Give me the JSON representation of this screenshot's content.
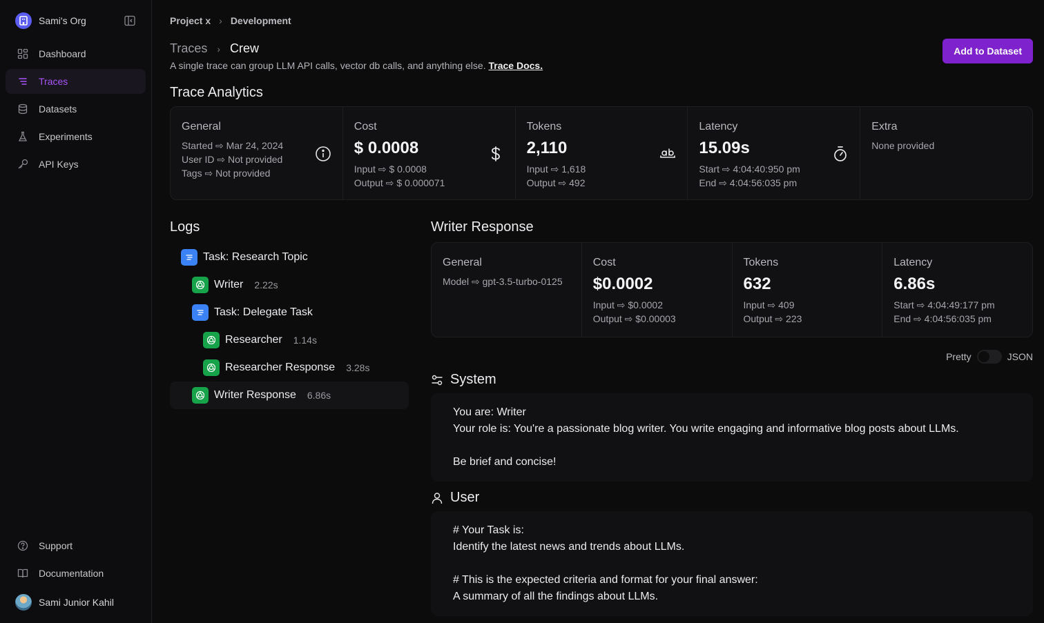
{
  "org": {
    "name": "Sami's Org"
  },
  "sidebar": {
    "items": [
      {
        "label": "Dashboard",
        "icon": "dashboard-icon"
      },
      {
        "label": "Traces",
        "icon": "traces-icon",
        "active": true
      },
      {
        "label": "Datasets",
        "icon": "database-icon"
      },
      {
        "label": "Experiments",
        "icon": "flask-icon"
      },
      {
        "label": "API Keys",
        "icon": "key-icon"
      }
    ],
    "bottom": [
      {
        "label": "Support",
        "icon": "help-circle-icon"
      },
      {
        "label": "Documentation",
        "icon": "book-icon"
      }
    ],
    "user": {
      "name": "Sami Junior Kahil"
    }
  },
  "breadcrumb": {
    "project": "Project x",
    "env": "Development"
  },
  "header": {
    "parent": "Traces",
    "current": "Crew",
    "subtitle": "A single trace can group LLM API calls, vector db calls, and anything else.",
    "docs_link": "Trace Docs.",
    "add_button": "Add to Dataset"
  },
  "analytics": {
    "title": "Trace Analytics",
    "general": {
      "label": "General",
      "started": "Started ⇨ Mar 24, 2024",
      "user": "User ID ⇨ Not provided",
      "tags": "Tags ⇨ Not provided"
    },
    "cost": {
      "label": "Cost",
      "value": "$ 0.0008",
      "input": "Input ⇨ $ 0.0008",
      "output": "Output ⇨ $ 0.000071"
    },
    "tokens": {
      "label": "Tokens",
      "value": "2,110",
      "input": "Input ⇨ 1,618",
      "output": "Output ⇨ 492"
    },
    "latency": {
      "label": "Latency",
      "value": "15.09s",
      "start": "Start ⇨ 4:04:40:950 pm",
      "end": "End ⇨ 4:04:56:035 pm"
    },
    "extra": {
      "label": "Extra",
      "value": "None provided"
    }
  },
  "logs": {
    "title": "Logs",
    "items": [
      {
        "label": "Task: Research Topic",
        "type": "task",
        "duration": ""
      },
      {
        "label": "Writer",
        "type": "llm",
        "duration": "2.22s"
      },
      {
        "label": "Task: Delegate Task",
        "type": "task",
        "duration": ""
      },
      {
        "label": "Researcher",
        "type": "llm",
        "duration": "1.14s"
      },
      {
        "label": "Researcher Response",
        "type": "llm",
        "duration": "3.28s"
      },
      {
        "label": "Writer Response",
        "type": "llm",
        "duration": "6.86s",
        "active": true
      }
    ]
  },
  "detail": {
    "title": "Writer Response",
    "general": {
      "label": "General",
      "model": "Model ⇨ gpt-3.5-turbo-0125"
    },
    "cost": {
      "label": "Cost",
      "value": "$0.0002",
      "input": "Input ⇨ $0.0002",
      "output": "Output ⇨ $0.00003"
    },
    "tokens": {
      "label": "Tokens",
      "value": "632",
      "input": "Input ⇨ 409",
      "output": "Output ⇨ 223"
    },
    "latency": {
      "label": "Latency",
      "value": "6.86s",
      "start": "Start ⇨ 4:04:49:177 pm",
      "end": "End ⇨ 4:04:56:035 pm"
    },
    "toggle": {
      "left": "Pretty",
      "right": "JSON"
    },
    "system": {
      "title": "System",
      "line1": "You are: Writer",
      "line2": "Your role is: You're a passionate blog writer. You write engaging and informative blog posts about LLMs.",
      "line3": "Be brief and concise!"
    },
    "user": {
      "title": "User",
      "line1": "# Your Task is:",
      "line2": "Identify the latest news and trends about LLMs.",
      "line3": "# This is the expected criteria and format for your final answer:",
      "line4": "A summary of all the findings about LLMs."
    }
  }
}
